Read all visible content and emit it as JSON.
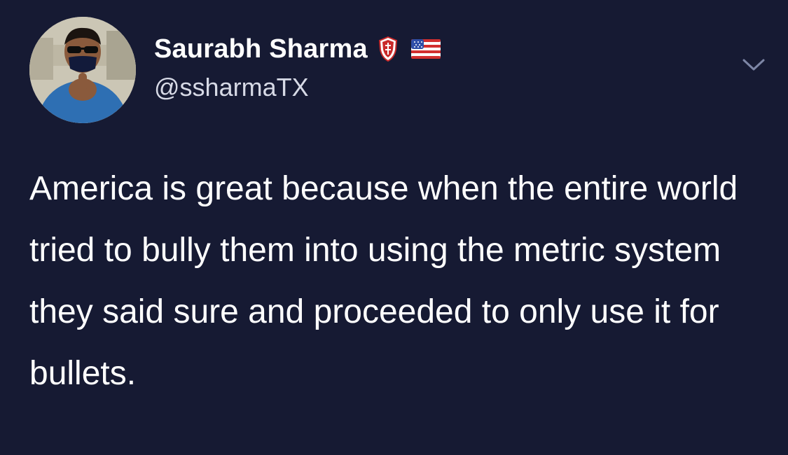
{
  "tweet": {
    "author": {
      "display_name": "Saurabh Sharma",
      "handle": "@ssharmaTX",
      "badges": [
        "shield-badge-icon",
        "us-flag-icon"
      ]
    },
    "text": "America is great because when the entire world tried to bully them into using the metric system they said sure and proceeded to only use it for bullets.",
    "menu_icon": "chevron-down-icon"
  },
  "colors": {
    "background": "#161a33",
    "text": "#ffffff",
    "handle": "#d7dae6",
    "chevron": "#7d86a6"
  }
}
